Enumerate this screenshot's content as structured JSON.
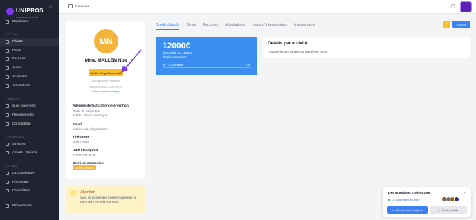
{
  "sidebar": {
    "brand": "UNIPROS",
    "brand_sub": "COOPERATIVE SAP",
    "sections": {
      "gestion": "GESTION",
      "finances": "FINANCES",
      "experience": "EXPÉRIENCE",
      "autres": "AUTRES"
    },
    "items": [
      {
        "label": "Dashboard"
      },
      {
        "label": "Clients"
      },
      {
        "label": "Devis"
      },
      {
        "label": "Factures"
      },
      {
        "label": "Avoirs"
      },
      {
        "label": "Acomptes"
      },
      {
        "label": "Attestations"
      },
      {
        "label": "Suivi paiements"
      },
      {
        "label": "Reversements"
      },
      {
        "label": "Comptabilité"
      },
      {
        "label": "Sinistres"
      },
      {
        "label": "Achats / Options"
      },
      {
        "label": "La coopérative"
      },
      {
        "label": "Parrainage"
      },
      {
        "label": "Paramètres"
      },
      {
        "label": "Déconnexion"
      }
    ]
  },
  "topbar": {
    "new_label": "Nouveau"
  },
  "profile": {
    "initials": "MN",
    "name": "Mme. MALLEM Noa",
    "badge": "Crédit d'impôt immédiat",
    "activation": "Activation non finalisée",
    "inscrit": "Inscrit le 12/01/2024 05:48",
    "paiement": "Paiement automatique",
    "address_label": "Adresse de facturation/intervention",
    "address_line1": "Route de Carpentras",
    "address_line2": "84800 L'isle-sur-la-Sorgue",
    "email_label": "Email",
    "email": "mallem.noa14@gmail.com",
    "phone_label": "Téléphone",
    "phone": "0605215066",
    "date_label": "Date inscription",
    "date": "12/01/2024 05:48",
    "last_label": "Dernière connexion",
    "last": "Jamais connecté"
  },
  "warning": {
    "title": "Attention",
    "text": "Vous ne pouvez pas modifier/supprimer un client qui s'est déjà connecté."
  },
  "tabs": [
    {
      "label": "Crédit d'impôt"
    },
    {
      "label": "Devis"
    },
    {
      "label": "Factures"
    },
    {
      "label": "Attestations"
    },
    {
      "label": "Lieux d'interventions"
    },
    {
      "label": "Intervenants"
    }
  ],
  "actions": {
    "yellow_icon": "⚡",
    "blue_label": "Actions"
  },
  "stat": {
    "amount": "12000€",
    "line1": "Disponible sur 12000€",
    "line2": "d'aides accordées",
    "used": "0€ TTC Dépensé",
    "percent_label": "0 %",
    "progress": 0
  },
  "details": {
    "title": "Détails par activité",
    "text": "Aucune facture éligible sur l'année en cours"
  },
  "chat": {
    "title": "Des questions ? Discutons !",
    "online": "Le support est en ligne",
    "btn1": "Discuter avec Unipros",
    "btn2": "Centre d'aide",
    "close": "×"
  },
  "colors": {
    "accent": "#3b82f6",
    "yellow": "#fbbf24",
    "sidebar": "#1f2430",
    "brand": "#7c3aed"
  }
}
